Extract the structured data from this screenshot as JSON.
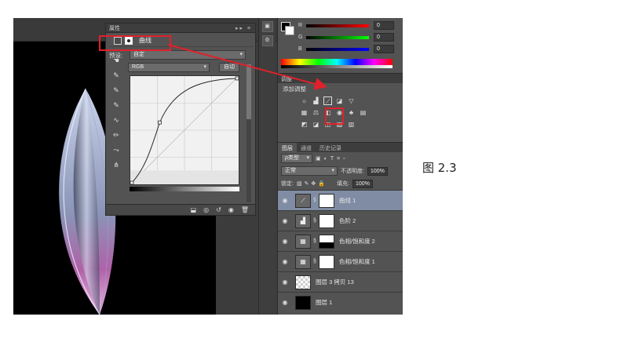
{
  "properties_panel": {
    "title": "属性",
    "header_controls": "▸▸ ≡",
    "adjustment_name": "曲线",
    "preset_label": "预设:",
    "preset_value": "自定",
    "channel_value": "RGB",
    "auto_button": "自动"
  },
  "color_panel": {
    "r_label": "R",
    "r_value": "0",
    "g_label": "G",
    "g_value": "0",
    "b_label": "B",
    "b_value": "0"
  },
  "adjustments_panel": {
    "header": "调整",
    "title": "添加调整"
  },
  "layers_panel": {
    "tabs": [
      "图层",
      "通道",
      "历史记录"
    ],
    "filter_kind": "ρ类型",
    "blend_mode": "正常",
    "opacity_label": "不透明度:",
    "opacity_value": "100%",
    "lock_label": "锁定:",
    "fill_label": "填充:",
    "fill_value": "100%",
    "layers": [
      {
        "name": "曲线 1",
        "selected": true
      },
      {
        "name": "色阶 2",
        "selected": false
      },
      {
        "name": "色相/饱和度 2",
        "selected": false
      },
      {
        "name": "色相/饱和度 1",
        "selected": false
      },
      {
        "name": "图层 3 拷贝 13",
        "selected": false
      },
      {
        "name": "图层 1",
        "selected": false
      }
    ]
  },
  "caption": "图  2.3",
  "colors": {
    "highlight_red": "#e0212b",
    "selected_layer": "#7f8ca3",
    "panel_bg": "#535353"
  }
}
